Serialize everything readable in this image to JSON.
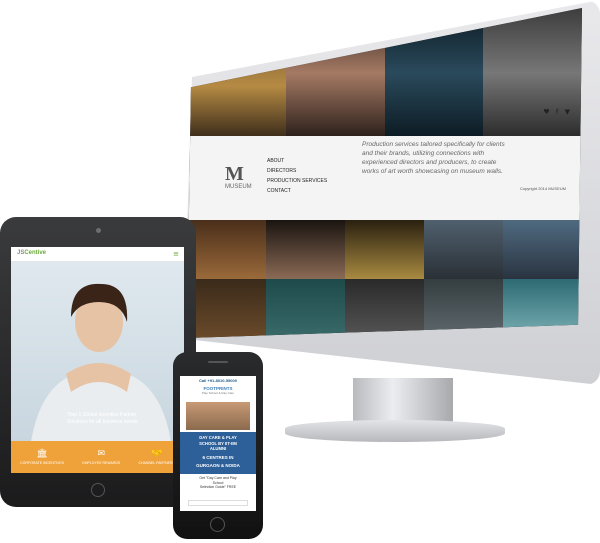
{
  "monitor": {
    "nav_items": [
      "ABOUT",
      "DIRECTORS",
      "PRODUCTION SERVICES",
      "CONTACT"
    ],
    "logo_letter": "M",
    "logo_caption": "MUSEUM",
    "tagline": "Production services tailored specifically for clients and their brands, utilizing connections with experienced directors and producers, to create works of art worth showcasing on museum walls.",
    "copyright": "Copyright 2014 MUSEUM",
    "social_icons": "♥ f ▼"
  },
  "tablet": {
    "brand_left": "JS",
    "brand_right": "Centive",
    "menu_icon": "≡",
    "hero_text": "Your 1 Global Incentive Partner. Solutions for all business needs.",
    "tiles": [
      {
        "icon": "🏛",
        "label": "CORPORATE INCENTIVES"
      },
      {
        "icon": "✉",
        "label": "EMPLOYEE REWARDS"
      },
      {
        "icon": "🤝",
        "label": "CHANNEL PARTNERS"
      }
    ]
  },
  "phone": {
    "call": "Call +91-8010-55000",
    "brand": "FOOTPRINTS",
    "brand_sub": "Play School & Day Care",
    "headline_1": "DAY CARE & PLAY",
    "headline_2": "SCHOOL BY IIT-IIM",
    "headline_3": "ALUMNI",
    "centres_1": "6 CENTRES IN",
    "centres_2": "GURGAON & NOIDA",
    "guide_1": "Get \"Day Care and Play",
    "guide_2": "School",
    "guide_3": "Selection Guide\" FREE"
  }
}
